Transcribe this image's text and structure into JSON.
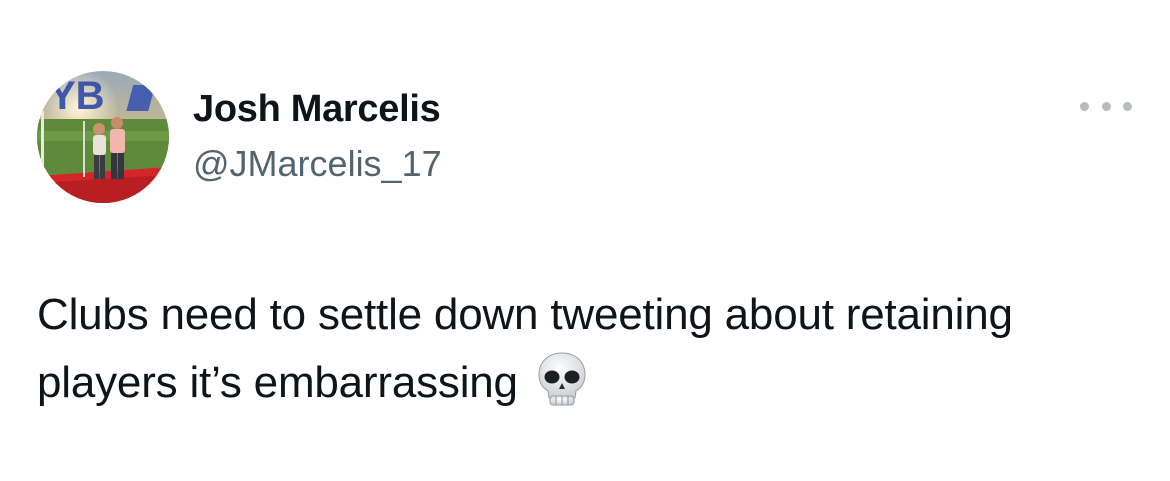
{
  "author": {
    "display_name": "Josh Marcelis",
    "handle": "@JMarcelis_17",
    "avatar_icon": "profile-photo"
  },
  "tweet": {
    "text": "Clubs need to settle down tweeting about retaining players it’s embarrassing",
    "emoji": "💀",
    "emoji_name": "skull-emoji"
  },
  "more_menu": {
    "icon": "more-options-icon"
  },
  "colors": {
    "text": "#0f1419",
    "handle": "#536471",
    "dots": "#b4bcc4"
  }
}
